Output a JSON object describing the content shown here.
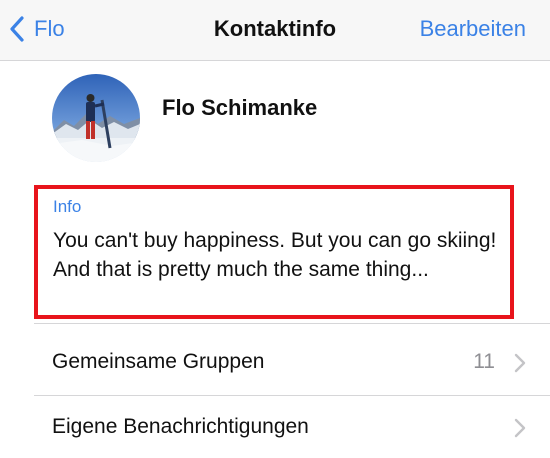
{
  "navbar": {
    "back_label": "Flo",
    "title": "Kontaktinfo",
    "edit_label": "Bearbeiten"
  },
  "profile": {
    "name": "Flo Schimanke"
  },
  "info": {
    "label": "Info",
    "text": "You can't buy happiness. But you can go skiing! And that is pretty much the same thing..."
  },
  "rows": [
    {
      "label": "Gemeinsame Gruppen",
      "value": "11"
    },
    {
      "label": "Eigene Benachrichtigungen",
      "value": ""
    }
  ],
  "colors": {
    "accent": "#3b82e6",
    "highlight_border": "#e8141b",
    "secondary_text": "#8e8e93"
  },
  "icons": {
    "back": "chevron-left-icon",
    "row_disclosure": "chevron-right-icon"
  }
}
